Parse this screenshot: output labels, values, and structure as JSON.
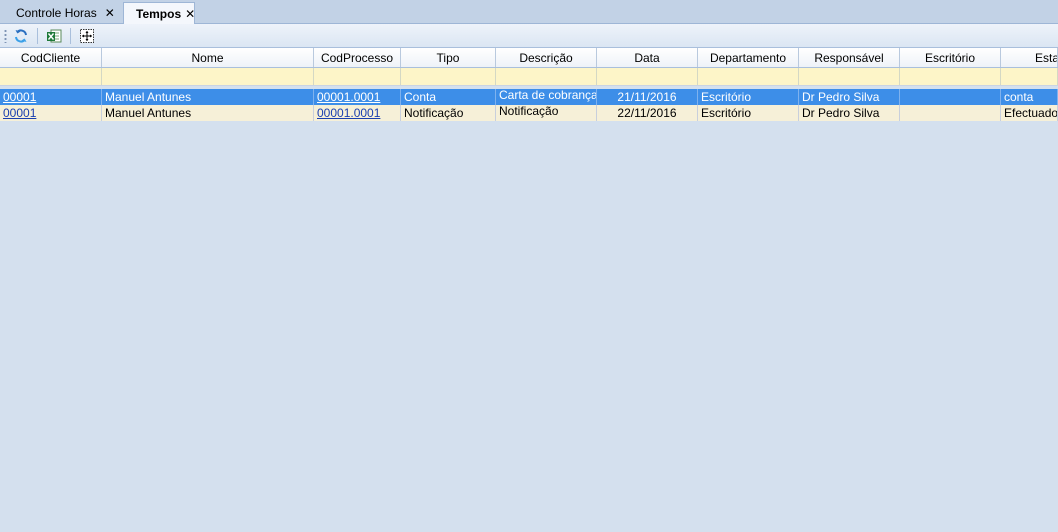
{
  "tabs": [
    {
      "label": "Controle Horas",
      "active": false
    },
    {
      "label": "Tempos",
      "active": true
    }
  ],
  "toolbar": {
    "buttons": [
      {
        "name": "refresh",
        "icon": "refresh-icon"
      },
      {
        "name": "export-excel",
        "icon": "excel-icon"
      },
      {
        "name": "fit-columns",
        "icon": "fit-columns-icon"
      }
    ]
  },
  "grid": {
    "columns": [
      "CodCliente",
      "Nome",
      "CodProcesso",
      "Tipo",
      "Descrição",
      "Data",
      "Departamento",
      "Responsável",
      "Escritório",
      "Estado"
    ],
    "rows": [
      {
        "selected": true,
        "cells": [
          "00001",
          "Manuel Antunes",
          "00001.0001",
          "Conta",
          "Carta de cobrança",
          "21/11/2016",
          "Escritório",
          "Dr Pedro Silva",
          "",
          "conta"
        ]
      },
      {
        "selected": false,
        "cells": [
          "00001",
          "Manuel Antunes",
          "00001.0001",
          "Notificação",
          "Notificação",
          "22/11/2016",
          "Escritório",
          "Dr Pedro Silva",
          "",
          "Efectuado"
        ]
      }
    ]
  },
  "colors": {
    "selected_row": "#3d8ee8",
    "alt_row": "#f6f0d8",
    "filter_row": "#fdf5c8",
    "background": "#d4e0ee"
  }
}
